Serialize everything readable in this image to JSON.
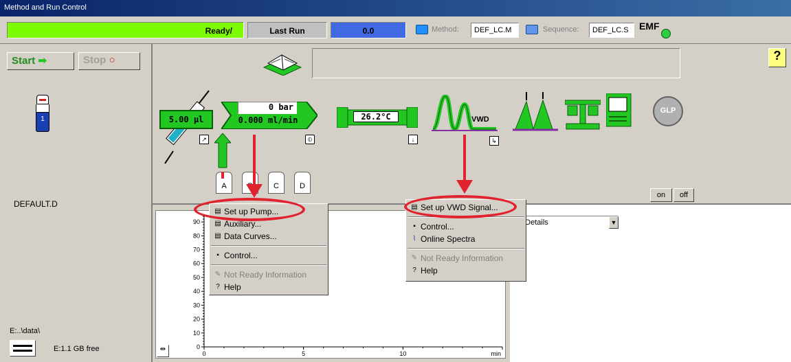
{
  "window": {
    "title": "Method and Run Control"
  },
  "status": {
    "state": "Ready/",
    "last_run_label": "Last Run",
    "last_run_value": "0.0",
    "method_label": "Method:",
    "method_value": "DEF_LC.M",
    "sequence_label": "Sequence:",
    "sequence_value": "DEF_LC.S",
    "emf_label": "EMF"
  },
  "controls": {
    "start_label": "Start",
    "stop_label": "Stop"
  },
  "vial": {
    "number": "1"
  },
  "data_file": "DEFAULT.D",
  "disk": {
    "path": "E:..\\data\\",
    "free": "E:1.1 GB free"
  },
  "instrument": {
    "injector_volume": "5.00 µl",
    "pump_pressure": "0 bar",
    "pump_flow": "0.000 ml/min",
    "column_temp": "26.2°C",
    "detector_label": "VWD",
    "glp_label": "GLP",
    "help_label": "?",
    "solvents": [
      "A",
      "B",
      "C",
      "D"
    ],
    "on_label": "on",
    "off_label": "off"
  },
  "pump_menu": {
    "items": [
      {
        "label": "Set up Pump...",
        "enabled": true,
        "icon": "list-icon"
      },
      {
        "label": "Auxiliary...",
        "enabled": true,
        "icon": "list-icon"
      },
      {
        "label": "Data Curves...",
        "enabled": true,
        "icon": "list-icon"
      },
      {
        "label": "Control...",
        "enabled": true,
        "icon": "control-icon"
      },
      {
        "label": "Not Ready Information",
        "enabled": false,
        "icon": "info-icon"
      },
      {
        "label": "Help",
        "enabled": true,
        "icon": "help-icon"
      }
    ]
  },
  "vwd_menu": {
    "items": [
      {
        "label": "Set up VWD Signal...",
        "enabled": true,
        "icon": "list-icon"
      },
      {
        "label": "Control...",
        "enabled": true,
        "icon": "control-icon"
      },
      {
        "label": "Online Spectra",
        "enabled": true,
        "icon": "spectra-icon"
      },
      {
        "label": "Not Ready Information",
        "enabled": false,
        "icon": "info-icon"
      },
      {
        "label": "Help",
        "enabled": true,
        "icon": "help-icon"
      }
    ]
  },
  "details_dropdown": {
    "value": "o Details"
  },
  "chart_data": {
    "type": "line",
    "y_ticks": [
      "90",
      "80",
      "70",
      "60",
      "50",
      "40",
      "30",
      "20",
      "10",
      "0"
    ],
    "x_ticks": [
      "0",
      "5",
      "10"
    ],
    "xlabel": "min",
    "ylim": [
      0,
      95
    ],
    "xlim": [
      0,
      15
    ],
    "series": []
  },
  "colors": {
    "ready": "#7cfc00",
    "accent_green": "#22c722",
    "annotation_red": "#e0232e",
    "last_run_blue": "#4169e1"
  }
}
